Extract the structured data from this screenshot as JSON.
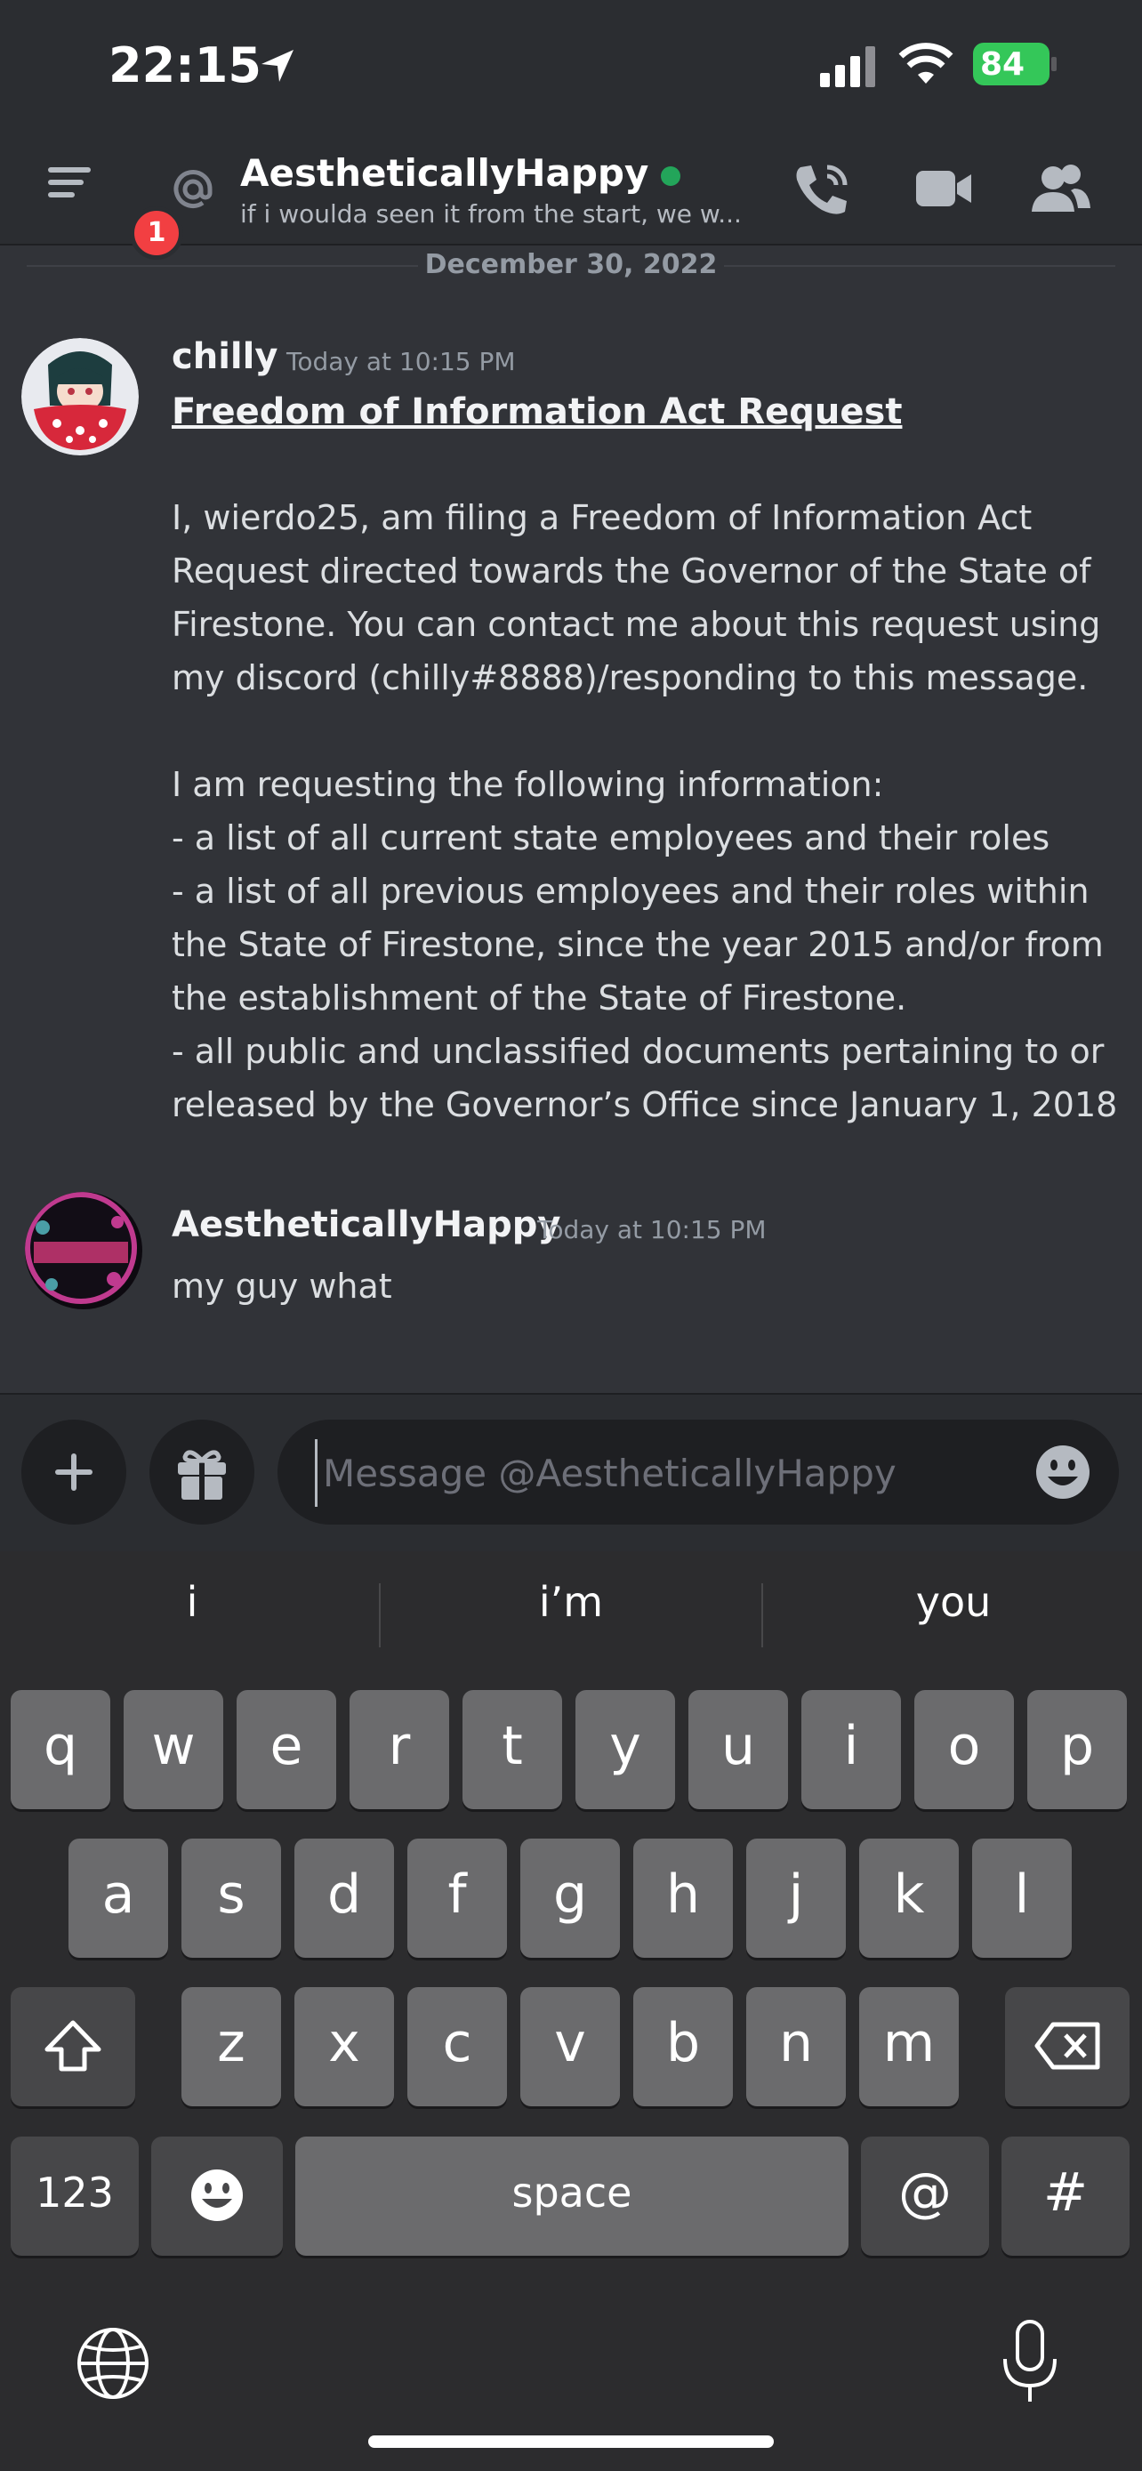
{
  "status_bar": {
    "time": "22:15",
    "battery": "84"
  },
  "header": {
    "name": "AestheticallyHappy",
    "status_text": "if i woulda seen it from the start, we w...",
    "badge_count": "1"
  },
  "chat": {
    "date_divider": "December 30, 2022",
    "messages": [
      {
        "author": "chilly",
        "timestamp": "Today at 10:15 PM",
        "title": "Freedom of Information Act Request",
        "lines": [
          "I, wierdo25, am filing a Freedom of Information Act",
          "Request directed towards the Governor of the State of",
          "Firestone. You can contact me about this request using",
          "my discord (chilly#8888)/responding to this message.",
          "",
          "I am requesting the following information:",
          "- a list of all current state employees and their roles",
          "- a list of all previous employees and their roles within",
          "the State of Firestone, since the year 2015 and/or from",
          "the establishment of the State of Firestone.",
          "- all public and unclassified documents pertaining to or",
          "released by the Governor’s Office since January 1, 2018"
        ]
      },
      {
        "author": "AestheticallyHappy",
        "timestamp": "Today at 10:15 PM",
        "lines": [
          "my guy what"
        ]
      }
    ]
  },
  "composer": {
    "placeholder": "Message @AestheticallyHappy"
  },
  "keyboard": {
    "suggestions": [
      "i",
      "i’m",
      "you"
    ],
    "row1": [
      "q",
      "w",
      "e",
      "r",
      "t",
      "y",
      "u",
      "i",
      "o",
      "p"
    ],
    "row2": [
      "a",
      "s",
      "d",
      "f",
      "g",
      "h",
      "j",
      "k",
      "l"
    ],
    "row3": [
      "z",
      "x",
      "c",
      "v",
      "b",
      "n",
      "m"
    ],
    "numbers_label": "123",
    "space_label": "space",
    "at_label": "@",
    "hash_label": "#"
  },
  "colors": {
    "background": "#313338",
    "header": "#2b2d31",
    "online": "#23a55a",
    "badge": "#f23f42",
    "battery": "#34c759"
  }
}
